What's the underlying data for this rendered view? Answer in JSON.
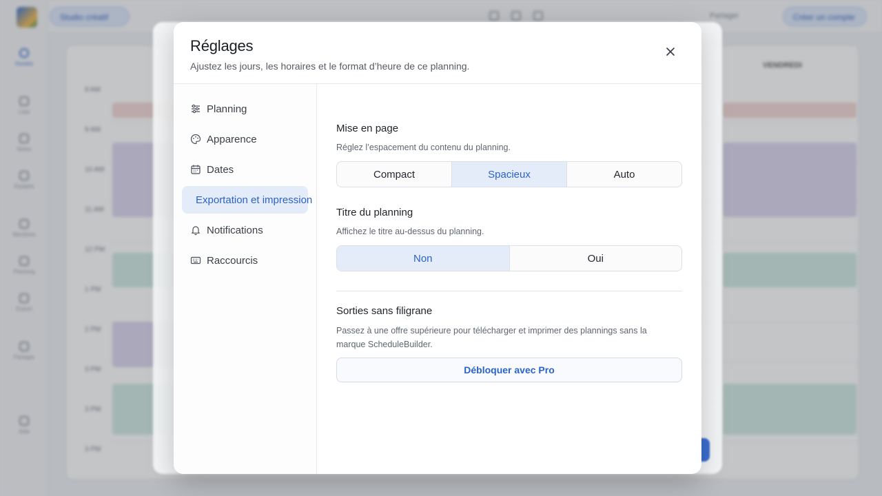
{
  "background": {
    "workspace_label": "Studio créatif",
    "nav_items": [
      "Horaire",
      "Liste",
      "Notes",
      "Équipes",
      "Membres",
      "Planning",
      "Export",
      "Partager",
      "Aide"
    ],
    "top_links": [
      "Partager",
      "Créer un compte"
    ],
    "hours": [
      "9 AM",
      "9 AM",
      "10 AM",
      "11 AM",
      "12 PM",
      "1 PM",
      "2 PM",
      "3 PM",
      "3 PM",
      "3 PM"
    ],
    "col_head": "VENDREDI"
  },
  "modal": {
    "title": "Réglages",
    "subtitle": "Ajustez les jours, les horaires et le format d’heure de ce planning.",
    "close_icon": "close-icon",
    "sidebar": [
      {
        "label": "Planning",
        "icon": "sliders-icon"
      },
      {
        "label": "Apparence",
        "icon": "palette-icon"
      },
      {
        "label": "Dates",
        "icon": "calendar-icon"
      },
      {
        "label": "Exportation et impression",
        "icon": "",
        "active": true
      },
      {
        "label": "Notifications",
        "icon": "bell-icon"
      },
      {
        "label": "Raccourcis",
        "icon": "keyboard-icon"
      }
    ],
    "layout_section": {
      "title": "Mise en page",
      "desc": "Réglez l’espacement du contenu du planning.",
      "options": [
        "Compact",
        "Spacieux",
        "Auto"
      ],
      "selected": "Spacieux"
    },
    "title_section": {
      "title": "Titre du planning",
      "desc": "Affichez le titre au-dessus du planning.",
      "options": [
        "Non",
        "Oui"
      ],
      "selected": "Non"
    },
    "watermark_section": {
      "title": "Sorties sans filigrane",
      "desc_line1": "Passez à une offre supérieure pour télécharger et imprimer des plannings sans la",
      "desc_line2": "marque ScheduleBuilder.",
      "button": "Débloquer avec Pro"
    }
  },
  "colors": {
    "accent": "#2b62c8",
    "selected_bg": "#e4ecfa"
  }
}
